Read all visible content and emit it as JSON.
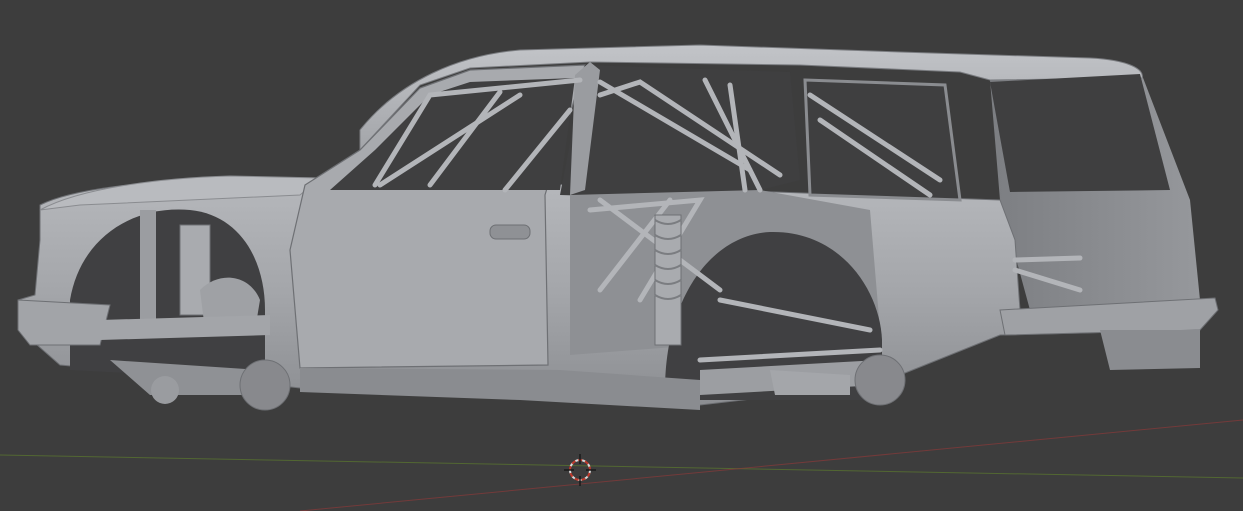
{
  "app": {
    "viewport_mode": "",
    "object_name": ""
  },
  "scene": {
    "background_color": "#3d3d3d",
    "grid_color": "#454545",
    "x_axis_color": "#8a3a3a",
    "y_axis_color": "#5c7a2e",
    "model_color": "#a7a9ad",
    "model_shadow_color": "#6e7074",
    "model_highlight_color": "#c4c6ca"
  },
  "icons": {
    "cursor": "3d-cursor-icon"
  }
}
